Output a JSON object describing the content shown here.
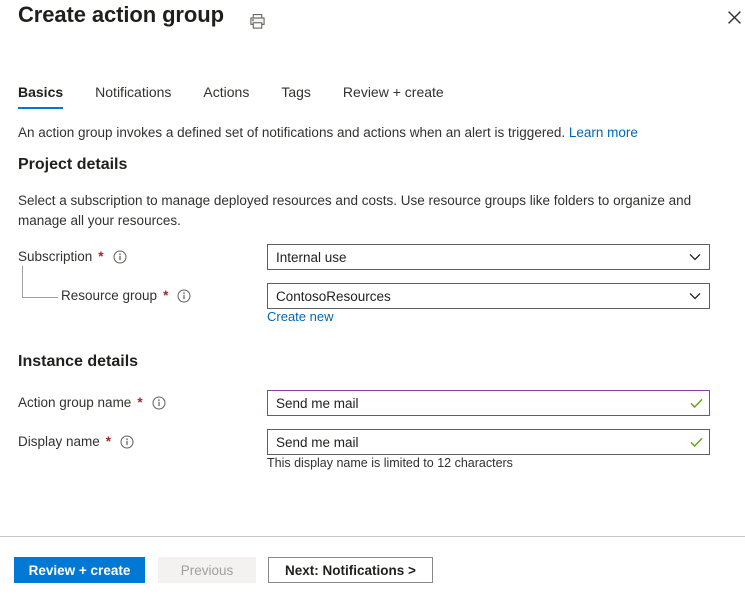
{
  "header": {
    "title": "Create action group",
    "print_icon": "printer-icon",
    "close_icon": "close-icon"
  },
  "tabs": [
    {
      "label": "Basics",
      "active": true
    },
    {
      "label": "Notifications",
      "active": false
    },
    {
      "label": "Actions",
      "active": false
    },
    {
      "label": "Tags",
      "active": false
    },
    {
      "label": "Review + create",
      "active": false
    }
  ],
  "intro": {
    "text": "An action group invokes a defined set of notifications and actions when an alert is triggered.",
    "link_label": "Learn more"
  },
  "project_details": {
    "heading": "Project details",
    "description": "Select a subscription to manage deployed resources and costs. Use resource groups like folders to organize and manage all your resources.",
    "subscription": {
      "label": "Subscription",
      "required": "*",
      "value": "Internal use",
      "info_icon": "info-icon",
      "chevron_icon": "chevron-down-icon"
    },
    "resource_group": {
      "label": "Resource group",
      "required": "*",
      "value": "ContosoResources",
      "info_icon": "info-icon",
      "chevron_icon": "chevron-down-icon",
      "create_new_label": "Create new"
    }
  },
  "instance_details": {
    "heading": "Instance details",
    "action_group_name": {
      "label": "Action group name",
      "required": "*",
      "value": "Send me mail",
      "info_icon": "info-icon",
      "status_icon": "checkmark-icon"
    },
    "display_name": {
      "label": "Display name",
      "required": "*",
      "value": "Send me mail",
      "info_icon": "info-icon",
      "status_icon": "checkmark-icon",
      "helper_text": "This display name is limited to 12 characters"
    }
  },
  "footer": {
    "review_create_label": "Review + create",
    "previous_label": "Previous",
    "next_label": "Next: Notifications >"
  },
  "colors": {
    "accent_blue": "#0078d4",
    "link_blue": "#0067b8",
    "required_red": "#a4262c",
    "valid_purple": "#8a3ea7",
    "check_green": "#69a318"
  }
}
